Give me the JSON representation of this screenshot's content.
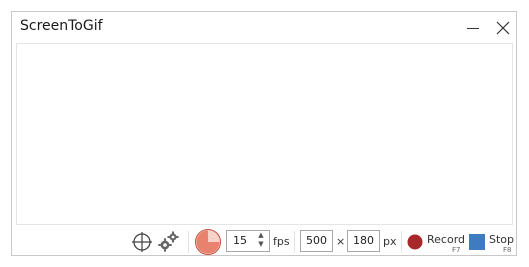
{
  "window": {
    "title": "ScreenToGif",
    "minimize_icon": "minimize-icon",
    "close_icon": "close-icon"
  },
  "toolbar": {
    "snap_icon": "crosshair-icon",
    "options_icon": "gears-icon",
    "recent_icon": "pie-timer-icon",
    "fps_value": "15",
    "fps_label": "fps",
    "width_value": "500",
    "times_label": "×",
    "height_value": "180",
    "px_label": "px",
    "record_label": "Record",
    "record_shortcut": "F7",
    "stop_label": "Stop",
    "stop_shortcut": "F8"
  },
  "colors": {
    "record": "#a8282a",
    "stop": "#3f7cbf",
    "pie": "#e8826e"
  }
}
